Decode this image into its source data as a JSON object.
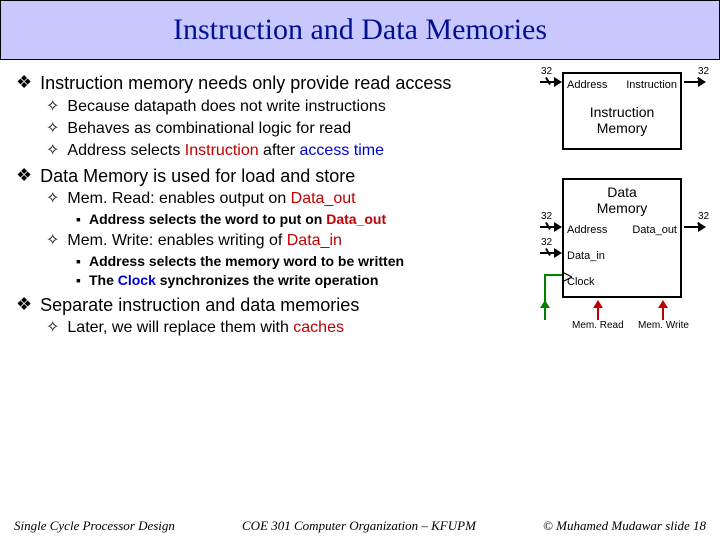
{
  "title": "Instruction and Data Memories",
  "bullets": {
    "b1": "Instruction memory needs only provide read access",
    "b1a": "Because datapath does not write instructions",
    "b1b": "Behaves as combinational logic for read",
    "b1c_pre": "Address selects ",
    "b1c_inst": "Instruction",
    "b1c_mid": " after ",
    "b1c_acc": "access time",
    "b2": "Data Memory is used for load and store",
    "b2a_pre": "Mem. Read: enables output on ",
    "b2a_do": "Data_out",
    "b2a1_pre": "Address selects the word to put on ",
    "b2a1_do": "Data_out",
    "b2b_pre": "Mem. Write: enables writing of ",
    "b2b_di": "Data_in",
    "b2b1": "Address selects the memory word to be written",
    "b2b2_pre": "The ",
    "b2b2_clk": "Clock",
    "b2b2_post": " synchronizes the write operation",
    "b3": "Separate instruction and data memories",
    "b3a_pre": "Later, we will replace them with ",
    "b3a_c": "caches"
  },
  "diagram": {
    "imem_title_l1": "Instruction",
    "imem_title_l2": "Memory",
    "imem_addr": "Address",
    "imem_inst": "Instruction",
    "bus32": "32",
    "dmem_title_l1": "Data",
    "dmem_title_l2": "Memory",
    "dmem_addr": "Address",
    "dmem_din": "Data_in",
    "dmem_dout": "Data_out",
    "dmem_clk": "Clock",
    "sig_read": "Mem. Read",
    "sig_write": "Mem. Write"
  },
  "footer": {
    "left": "Single Cycle Processor Design",
    "center": "COE 301 Computer Organization – KFUPM",
    "right": "© Muhamed Mudawar  slide 18"
  }
}
